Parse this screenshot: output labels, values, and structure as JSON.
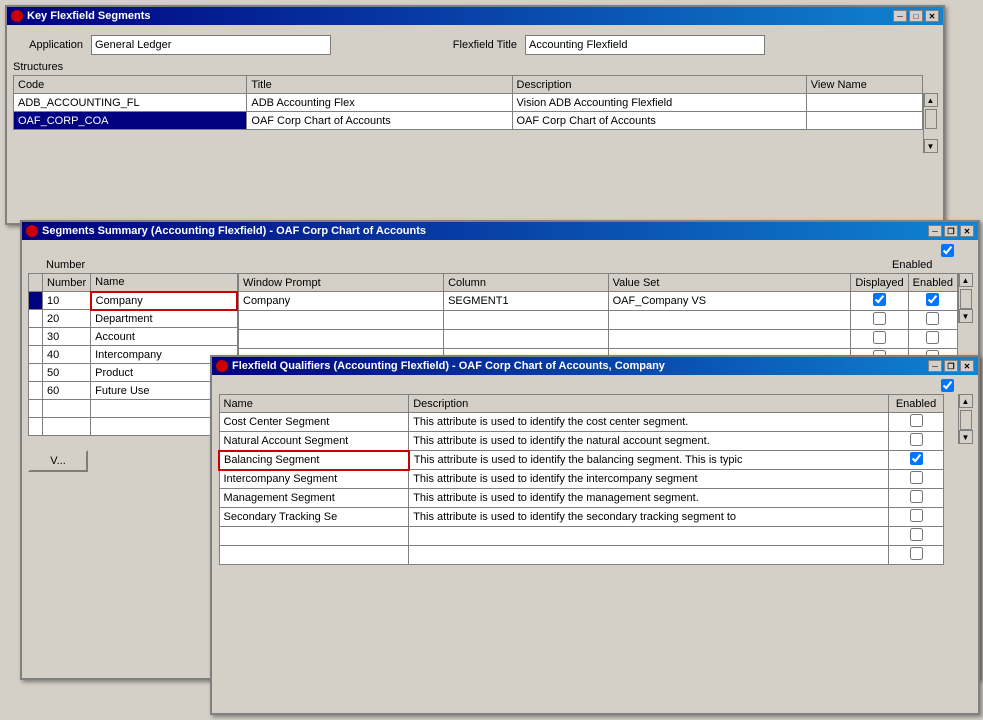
{
  "mainWindow": {
    "title": "Key Flexfield Segments",
    "application_label": "Application",
    "application_value": "General Ledger",
    "flexfield_title_label": "Flexfield Title",
    "flexfield_title_value": "Accounting Flexfield",
    "structures_label": "Structures",
    "table": {
      "columns": [
        "Code",
        "Title",
        "Description",
        "View Name"
      ],
      "rows": [
        {
          "code": "ADB_ACCOUNTING_FL",
          "title": "ADB Accounting Flex",
          "description": "Vision ADB Accounting Flexfield",
          "view_name": ""
        },
        {
          "code": "OAF_CORP_COA",
          "title": "OAF Corp Chart of Accounts",
          "description": "OAF Corp Chart of Accounts",
          "view_name": ""
        }
      ]
    }
  },
  "segmentsWindow": {
    "title": "Segments Summary (Accounting Flexfield) - OAF Corp Chart of Accounts",
    "table": {
      "columns": [
        "Number",
        "Name",
        "Window Prompt",
        "Column",
        "Value Set",
        "Displayed",
        "Enabled"
      ],
      "rows": [
        {
          "number": "10",
          "name": "Company",
          "prompt": "Company",
          "column": "SEGMENT1",
          "value_set": "OAF_Company VS",
          "displayed": true,
          "enabled": true,
          "selected": true
        },
        {
          "number": "20",
          "name": "Department",
          "prompt": "",
          "column": "",
          "value_set": "",
          "displayed": false,
          "enabled": false
        },
        {
          "number": "30",
          "name": "Account",
          "prompt": "",
          "column": "",
          "value_set": "",
          "displayed": false,
          "enabled": false
        },
        {
          "number": "40",
          "name": "Intercompany",
          "prompt": "",
          "column": "",
          "value_set": "",
          "displayed": false,
          "enabled": false
        },
        {
          "number": "50",
          "name": "Product",
          "prompt": "",
          "column": "",
          "value_set": "",
          "displayed": false,
          "enabled": false
        },
        {
          "number": "60",
          "name": "Future Use",
          "prompt": "",
          "column": "",
          "value_set": "",
          "displayed": false,
          "enabled": false
        }
      ]
    }
  },
  "qualifiersWindow": {
    "title": "Flexfield Qualifiers (Accounting Flexfield) - OAF Corp Chart of Accounts, Company",
    "table": {
      "columns": [
        "Name",
        "Description",
        "Enabled"
      ],
      "rows": [
        {
          "name": "Cost Center Segment",
          "description": "This attribute is used to identify the cost center segment.",
          "enabled": false
        },
        {
          "name": "Natural Account Segment",
          "description": "This attribute is used to identify the natural account segment.",
          "enabled": false
        },
        {
          "name": "Balancing Segment",
          "description": "This attribute is used to identify the balancing segment. This is typic",
          "enabled": true,
          "selected": true
        },
        {
          "name": "Intercompany Segment",
          "description": "This attribute is used to identify the intercompany segment",
          "enabled": false
        },
        {
          "name": "Management Segment",
          "description": "This attribute is used to identify the management segment.",
          "enabled": false
        },
        {
          "name": "Secondary Tracking Se",
          "description": "This attribute is used to identify the secondary tracking segment to",
          "enabled": false
        },
        {
          "name": "",
          "description": "",
          "enabled": false
        },
        {
          "name": "",
          "description": "",
          "enabled": false
        }
      ]
    }
  },
  "icons": {
    "close": "✕",
    "minimize": "─",
    "maximize": "□",
    "restore": "❐",
    "arrow_up": "▲",
    "arrow_down": "▼"
  }
}
